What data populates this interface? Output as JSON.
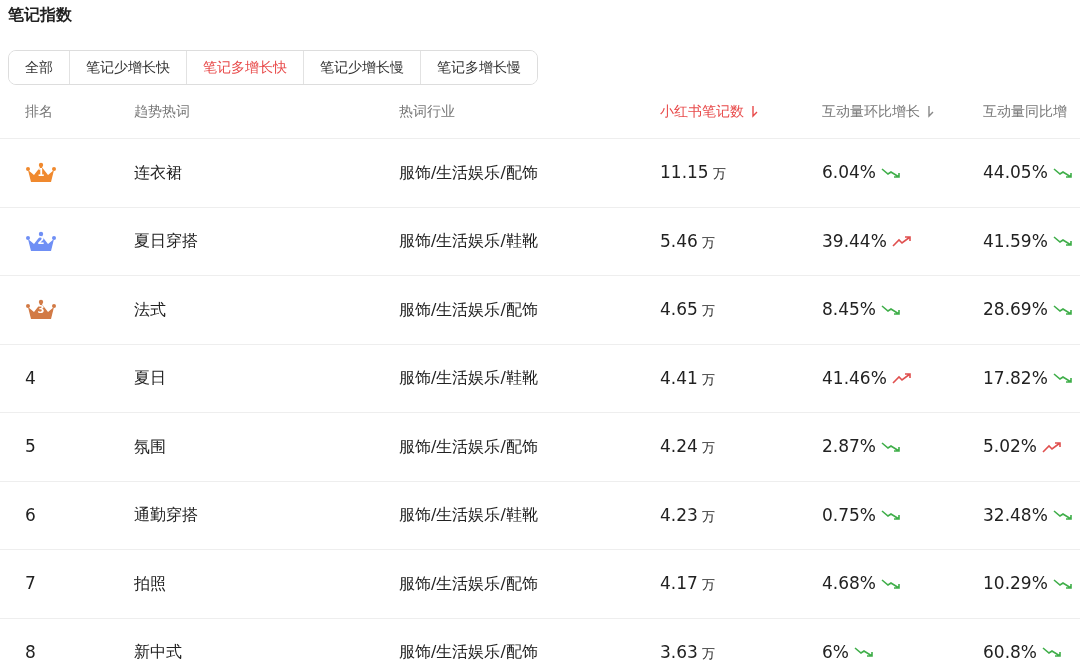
{
  "title": "笔记指数",
  "tabs": [
    {
      "label": "全部",
      "selected": false
    },
    {
      "label": "笔记少增长快",
      "selected": false
    },
    {
      "label": "笔记多增长快",
      "selected": true
    },
    {
      "label": "笔记少增长慢",
      "selected": false
    },
    {
      "label": "笔记多增长慢",
      "selected": false
    }
  ],
  "table": {
    "columns": [
      {
        "label": "排名",
        "sorted": false,
        "sortable": false
      },
      {
        "label": "趋势热词",
        "sorted": false,
        "sortable": false
      },
      {
        "label": "热词行业",
        "sorted": false,
        "sortable": false
      },
      {
        "label": "小红书笔记数",
        "sorted": true,
        "sortable": true
      },
      {
        "label": "互动量环比增长",
        "sorted": false,
        "sortable": true
      },
      {
        "label": "互动量同比增",
        "sorted": false,
        "sortable": false
      }
    ],
    "rows": [
      {
        "rank": "1",
        "kind": "crown",
        "color": "#f0892e",
        "keyword": "连衣裙",
        "industry": "服饰/生活娱乐/配饰",
        "notes": "11.15",
        "unit": "万",
        "mom": "6.04%",
        "mom_rising": false,
        "yoy": "44.05%",
        "yoy_rising": false
      },
      {
        "rank": "2",
        "kind": "crown",
        "color": "#6f8ff5",
        "keyword": "夏日穿搭",
        "industry": "服饰/生活娱乐/鞋靴",
        "notes": "5.46",
        "unit": "万",
        "mom": "39.44%",
        "mom_rising": true,
        "yoy": "41.59%",
        "yoy_rising": false
      },
      {
        "rank": "3",
        "kind": "crown",
        "color": "#d27a45",
        "keyword": "法式",
        "industry": "服饰/生活娱乐/配饰",
        "notes": "4.65",
        "unit": "万",
        "mom": "8.45%",
        "mom_rising": false,
        "yoy": "28.69%",
        "yoy_rising": false
      },
      {
        "rank": "4",
        "kind": "plain",
        "keyword": "夏日",
        "industry": "服饰/生活娱乐/鞋靴",
        "notes": "4.41",
        "unit": "万",
        "mom": "41.46%",
        "mom_rising": true,
        "yoy": "17.82%",
        "yoy_rising": false
      },
      {
        "rank": "5",
        "kind": "plain",
        "keyword": "氛围",
        "industry": "服饰/生活娱乐/配饰",
        "notes": "4.24",
        "unit": "万",
        "mom": "2.87%",
        "mom_rising": false,
        "yoy": "5.02%",
        "yoy_rising": true
      },
      {
        "rank": "6",
        "kind": "plain",
        "keyword": "通勤穿搭",
        "industry": "服饰/生活娱乐/鞋靴",
        "notes": "4.23",
        "unit": "万",
        "mom": "0.75%",
        "mom_rising": false,
        "yoy": "32.48%",
        "yoy_rising": false
      },
      {
        "rank": "7",
        "kind": "plain",
        "keyword": "拍照",
        "industry": "服饰/生活娱乐/配饰",
        "notes": "4.17",
        "unit": "万",
        "mom": "4.68%",
        "mom_rising": false,
        "yoy": "10.29%",
        "yoy_rising": false
      },
      {
        "rank": "8",
        "kind": "plain",
        "keyword": "新中式",
        "industry": "服饰/生活娱乐/配饰",
        "notes": "3.63",
        "unit": "万",
        "mom": "6%",
        "mom_rising": false,
        "yoy": "60.8%",
        "yoy_rising": false
      }
    ]
  }
}
